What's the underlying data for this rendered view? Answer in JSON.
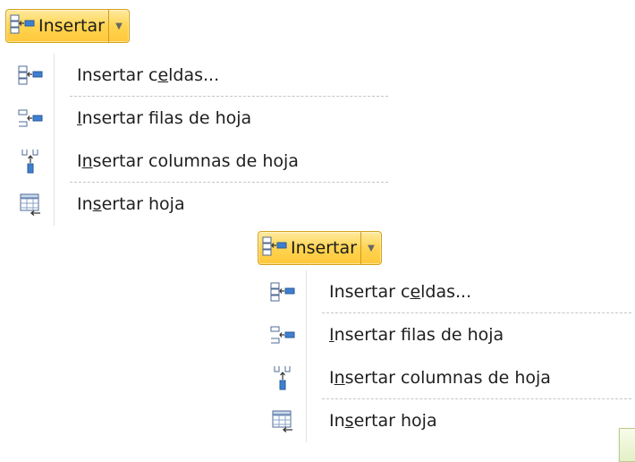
{
  "groups": [
    {
      "button": {
        "label": "Insertar",
        "icon": "insert-cells-icon"
      },
      "menu": [
        {
          "pre": "Insertar c",
          "key": "e",
          "post": "ldas...",
          "icon": "insert-cells-icon"
        },
        {
          "pre": "",
          "key": "I",
          "post": "nsertar filas de hoja",
          "icon": "insert-rows-icon"
        },
        {
          "pre": "I",
          "key": "n",
          "post": "sertar columnas de hoja",
          "icon": "insert-columns-icon"
        },
        {
          "pre": "In",
          "key": "s",
          "post": "ertar hoja",
          "icon": "insert-sheet-icon"
        }
      ]
    },
    {
      "button": {
        "label": "Insertar",
        "icon": "insert-cells-icon"
      },
      "menu": [
        {
          "pre": "Insertar c",
          "key": "e",
          "post": "ldas...",
          "icon": "insert-cells-icon"
        },
        {
          "pre": "",
          "key": "I",
          "post": "nsertar filas de hoja",
          "icon": "insert-rows-icon"
        },
        {
          "pre": "I",
          "key": "n",
          "post": "sertar columnas de hoja",
          "icon": "insert-columns-icon"
        },
        {
          "pre": "In",
          "key": "s",
          "post": "ertar hoja",
          "icon": "insert-sheet-icon"
        }
      ]
    }
  ],
  "colors": {
    "button_gradient_top": "#ffeaa0",
    "button_gradient_bottom": "#ffc83a",
    "button_border": "#d6a21c",
    "separator": "#c5c5c5",
    "tooltip_fill": "#e3f0c8"
  }
}
